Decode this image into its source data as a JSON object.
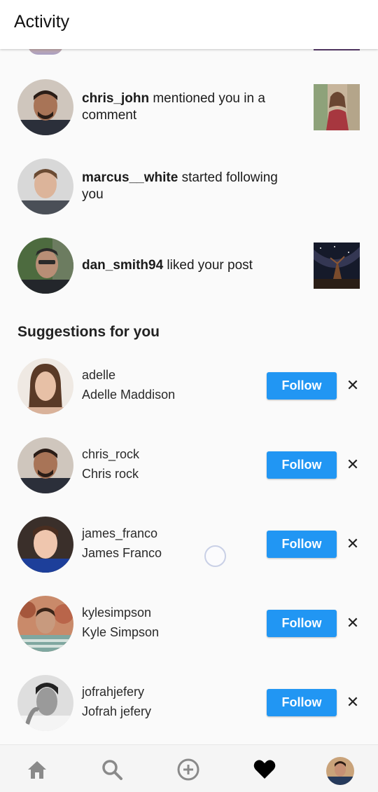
{
  "appbar": {
    "title": "Activity"
  },
  "activity": [
    {
      "username": "chris_john",
      "action": " mentioned you in a comment",
      "avatar_icon": "avatar-chris-john",
      "thumbnail_icon": "post-thumbnail-woman"
    },
    {
      "username": "marcus__white",
      "action": " started following you",
      "avatar_icon": "avatar-marcus-white"
    },
    {
      "username": "dan_smith94",
      "action": " liked your post",
      "avatar_icon": "avatar-dan-smith94",
      "thumbnail_icon": "post-thumbnail-night-sky"
    }
  ],
  "suggestions": {
    "title": "Suggestions for you",
    "follow_label": "Follow",
    "dismiss_label": "✕",
    "items": [
      {
        "username": "adelle",
        "full_name": "Adelle Maddison"
      },
      {
        "username": "chris_rock",
        "full_name": "Chris rock"
      },
      {
        "username": "james_franco",
        "full_name": "James Franco"
      },
      {
        "username": "kylesimpson",
        "full_name": "Kyle Simpson"
      },
      {
        "username": "jofrahjefery",
        "full_name": "Jofrah jefery"
      }
    ]
  },
  "bottom_nav": {
    "items": [
      "home-icon",
      "search-icon",
      "add-icon",
      "heart-icon",
      "profile-avatar"
    ],
    "active": "heart-icon"
  },
  "colors": {
    "accent": "#2196f3",
    "background": "#fafafa",
    "appbar": "#ffffff",
    "nav_inactive": "#8a8a8a"
  }
}
